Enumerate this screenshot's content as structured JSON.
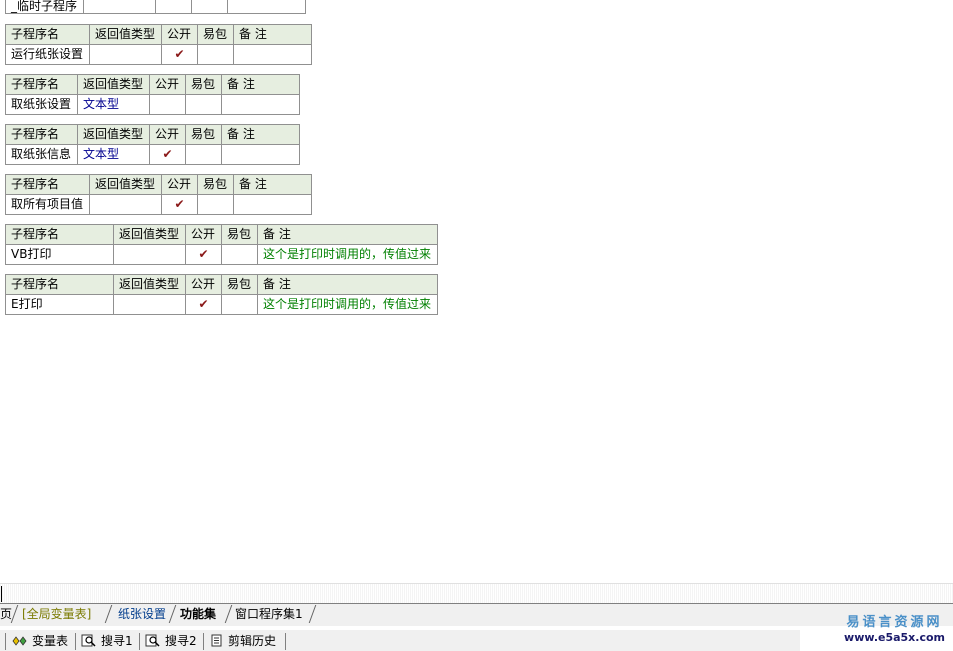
{
  "headers": {
    "name": "子程序名",
    "ret": "返回值类型",
    "pub": "公开",
    "easy": "易包",
    "note": "备 注"
  },
  "check_mark": "✔",
  "truncated_row": {
    "name": "_临时子程序"
  },
  "subprograms": [
    {
      "name": "运行纸张设置",
      "ret": "",
      "pub": true,
      "easy": "",
      "note": ""
    },
    {
      "name": "取纸张设置",
      "ret": "文本型",
      "pub": false,
      "easy": "",
      "note": ""
    },
    {
      "name": "取纸张信息",
      "ret": "文本型",
      "pub": true,
      "easy": "",
      "note": ""
    },
    {
      "name": "取所有项目值",
      "ret": "",
      "pub": true,
      "easy": "",
      "note": ""
    },
    {
      "name": "VB打印",
      "ret": "",
      "pub": true,
      "easy": "",
      "note": "这个是打印时调用的，传值过来"
    },
    {
      "name": "E打印",
      "ret": "",
      "pub": true,
      "easy": "",
      "note": "这个是打印时调用的，传值过来"
    }
  ],
  "tabs": {
    "home": "页",
    "global": "[全局变量表]",
    "paper": "纸张设置",
    "func": "功能集",
    "win": "窗口程序集1"
  },
  "bottom": {
    "vars": "变量表",
    "search1": "搜寻1",
    "search2": "搜寻2",
    "clip": "剪辑历史"
  },
  "logo": {
    "cn": "易语言资源网",
    "url": "www.e5a5x.com"
  }
}
